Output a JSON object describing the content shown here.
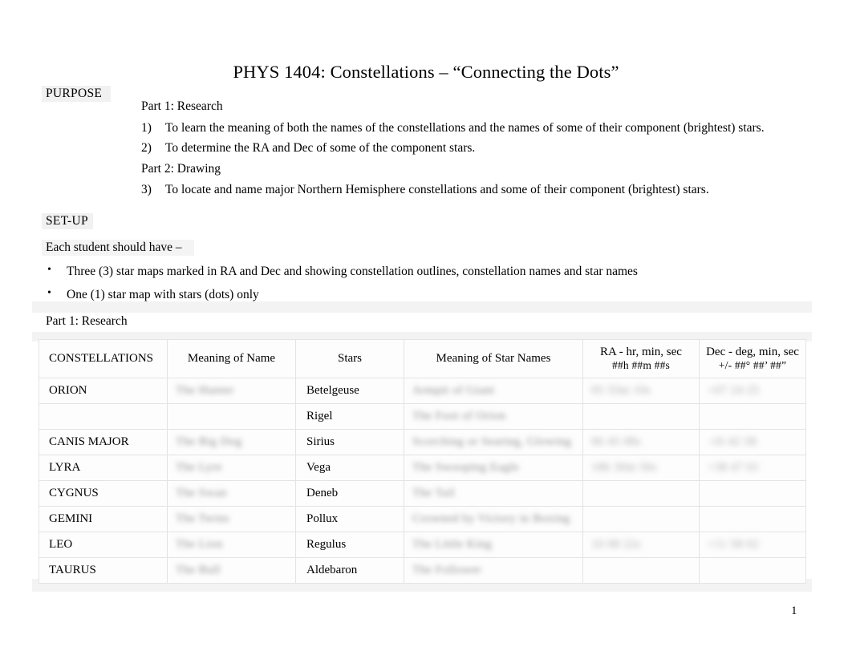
{
  "document": {
    "title": "PHYS 1404: Constellations – “Connecting the Dots”",
    "page_number": "1"
  },
  "purpose": {
    "heading": "PURPOSE",
    "part1_label": "Part 1: Research",
    "part2_label": "Part 2: Drawing",
    "objectives": [
      {
        "marker": "1)",
        "text": "To learn the meaning of both the names of the constellations and the names of some of their component (brightest) stars."
      },
      {
        "marker": "2)",
        "text": "To determine the RA and Dec of some of the component stars."
      },
      {
        "marker": "3)",
        "text": "To locate and name major Northern Hemisphere constellations and some of their component (brightest) stars."
      }
    ]
  },
  "setup": {
    "heading": "SET-UP",
    "lead": "Each student should have –",
    "bullet_glyph": "•",
    "items": [
      "Three (3) star maps marked in RA and Dec and showing constellation outlines, constellation names and star names",
      "One (1) star map with stars (dots) only"
    ]
  },
  "part_section": {
    "label": "Part 1: Research"
  },
  "table": {
    "headers": [
      {
        "main": "CONSTELLATIONS",
        "sub": ""
      },
      {
        "main": "Meaning of Name",
        "sub": ""
      },
      {
        "main": "Stars",
        "sub": ""
      },
      {
        "main": "Meaning of Star Names",
        "sub": ""
      },
      {
        "main": "RA  - hr, min, sec",
        "sub": "##h   ##m   ##s"
      },
      {
        "main": "Dec  - deg, min, sec",
        "sub": "+/- ##° ##’  ##”"
      }
    ],
    "rows": [
      {
        "constellation": "ORION",
        "meaning_of_name": "The Hunter",
        "star": "Betelgeuse",
        "meaning_of_star_name": "Armpit of Giant",
        "ra": "05 55m 10s",
        "dec": "+07 24 25"
      },
      {
        "constellation": "",
        "meaning_of_name": "",
        "star": "Rigel",
        "meaning_of_star_name": "The Foot of Orion",
        "ra": "",
        "dec": ""
      },
      {
        "constellation": "CANIS MAJOR",
        "meaning_of_name": "The Big Dog",
        "star": "Sirius",
        "meaning_of_star_name": "Scorching or Searing, Glowing",
        "ra": "06 45 08s",
        "dec": "-16 42 58"
      },
      {
        "constellation": "LYRA",
        "meaning_of_name": "The Lyre",
        "star": "Vega",
        "meaning_of_star_name": "The Swooping Eagle",
        "ra": "18h 36m 56s",
        "dec": "+38 47 01"
      },
      {
        "constellation": "CYGNUS",
        "meaning_of_name": "The Swan",
        "star": "Deneb",
        "meaning_of_star_name": "The Tail",
        "ra": "",
        "dec": ""
      },
      {
        "constellation": "GEMINI",
        "meaning_of_name": "The Twins",
        "star": "Pollux",
        "meaning_of_star_name": "Crowned by Victory in Boxing",
        "ra": "",
        "dec": ""
      },
      {
        "constellation": "LEO",
        "meaning_of_name": "The Lion",
        "star": "Regulus",
        "meaning_of_star_name": "The Little King",
        "ra": "10 08 22s",
        "dec": "+11 58 02"
      },
      {
        "constellation": "TAURUS",
        "meaning_of_name": "The Bull",
        "star": "Aldebaron",
        "meaning_of_star_name": "The Follower",
        "ra": "",
        "dec": ""
      }
    ]
  }
}
